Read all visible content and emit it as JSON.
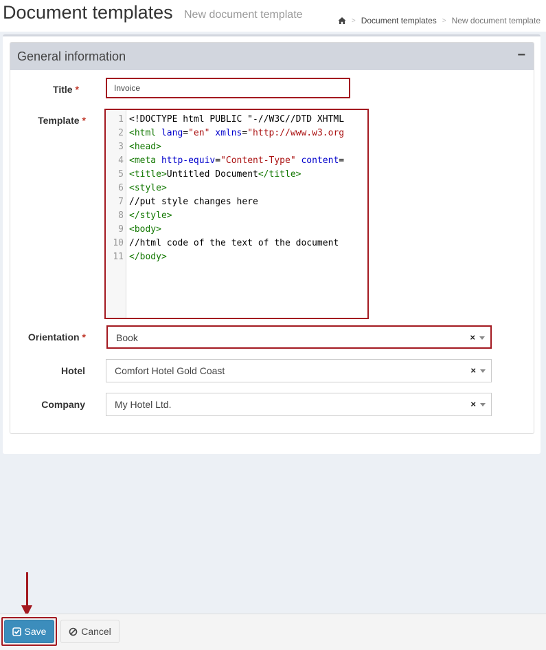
{
  "header": {
    "title": "Document templates",
    "subtitle": "New document template",
    "breadcrumb": {
      "home_icon": "home-icon",
      "item1": "Document templates",
      "item2": "New document template"
    }
  },
  "panel": {
    "title": "General information",
    "collapse_symbol": "−"
  },
  "form": {
    "title_label": "Title",
    "title_value": "Invoice",
    "required_mark": "*",
    "template_label": "Template",
    "template_lines": [
      "1",
      "2",
      "3",
      "4",
      "5",
      "6",
      "7",
      "8",
      "9",
      "10",
      "11"
    ],
    "orientation_label": "Orientation",
    "orientation_value": "Book",
    "hotel_label": "Hotel",
    "hotel_value": "Comfort Hotel Gold Coast",
    "company_label": "Company",
    "company_value": "My Hotel Ltd.",
    "clear_symbol": "×"
  },
  "code": {
    "l1": "<!DOCTYPE html PUBLIC \"-//W3C//DTD XHTML",
    "l2_tag": "<html ",
    "l2_a1": "lang",
    "l2_eq1": "=",
    "l2_s1": "\"en\"",
    "l2_a2": " xmlns",
    "l2_eq2": "=",
    "l2_s2": "\"http://www.w3.org",
    "l3": "<head>",
    "l4_tag": "<meta ",
    "l4_a1": "http-equiv",
    "l4_eq1": "=",
    "l4_s1": "\"Content-Type\"",
    "l4_a2": " content",
    "l4_eq2": "=",
    "l5_t1": "<title>",
    "l5_txt": "Untitled Document",
    "l5_t2": "</title>",
    "l6": "<style>",
    "l7": "//put style changes here",
    "l8": "</style>",
    "l9": "<body>",
    "l10": "//html code of the text of the document",
    "l11": "</body>"
  },
  "footer": {
    "save_label": "Save",
    "cancel_label": "Cancel",
    "save_icon": "check-square-icon",
    "cancel_icon": "ban-icon"
  },
  "colors": {
    "primary": "#3c8dbc",
    "highlight": "#a31920",
    "panel_head": "#d2d6de"
  }
}
